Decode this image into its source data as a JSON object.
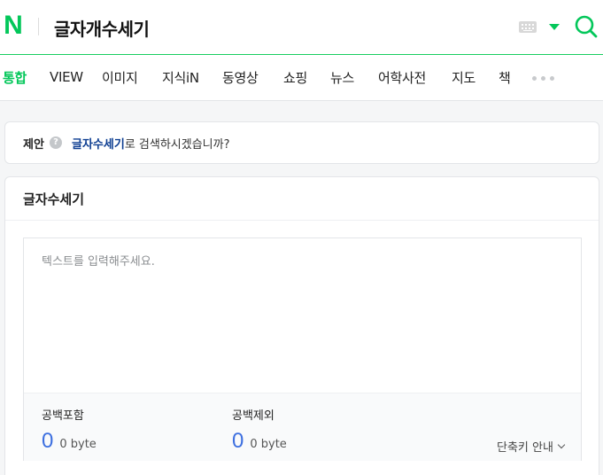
{
  "header": {
    "logo": "N",
    "query": "글자개수세기",
    "keyboard_icon": "keyboard-icon",
    "search_icon": "search-icon",
    "accent_color": "#03c75a"
  },
  "tabs": [
    {
      "label": "통합",
      "active": true
    },
    {
      "label": "VIEW",
      "active": false
    },
    {
      "label": "이미지",
      "active": false
    },
    {
      "label": "지식iN",
      "active": false
    },
    {
      "label": "동영상",
      "active": false
    },
    {
      "label": "쇼핑",
      "active": false
    },
    {
      "label": "뉴스",
      "active": false
    },
    {
      "label": "어학사전",
      "active": false
    },
    {
      "label": "지도",
      "active": false
    },
    {
      "label": "책",
      "active": false
    }
  ],
  "suggest": {
    "label": "제안",
    "help": "?",
    "link": "글자수세기",
    "rest": "로 검색하시겠습니까?"
  },
  "counter": {
    "title": "글자수세기",
    "placeholder": "텍스트를 입력해주세요.",
    "with_space_label": "공백포함",
    "with_space_count": "0",
    "with_space_bytes": "0 byte",
    "no_space_label": "공백제외",
    "no_space_count": "0",
    "no_space_bytes": "0 byte",
    "shortcut_label": "단축키 안내"
  }
}
